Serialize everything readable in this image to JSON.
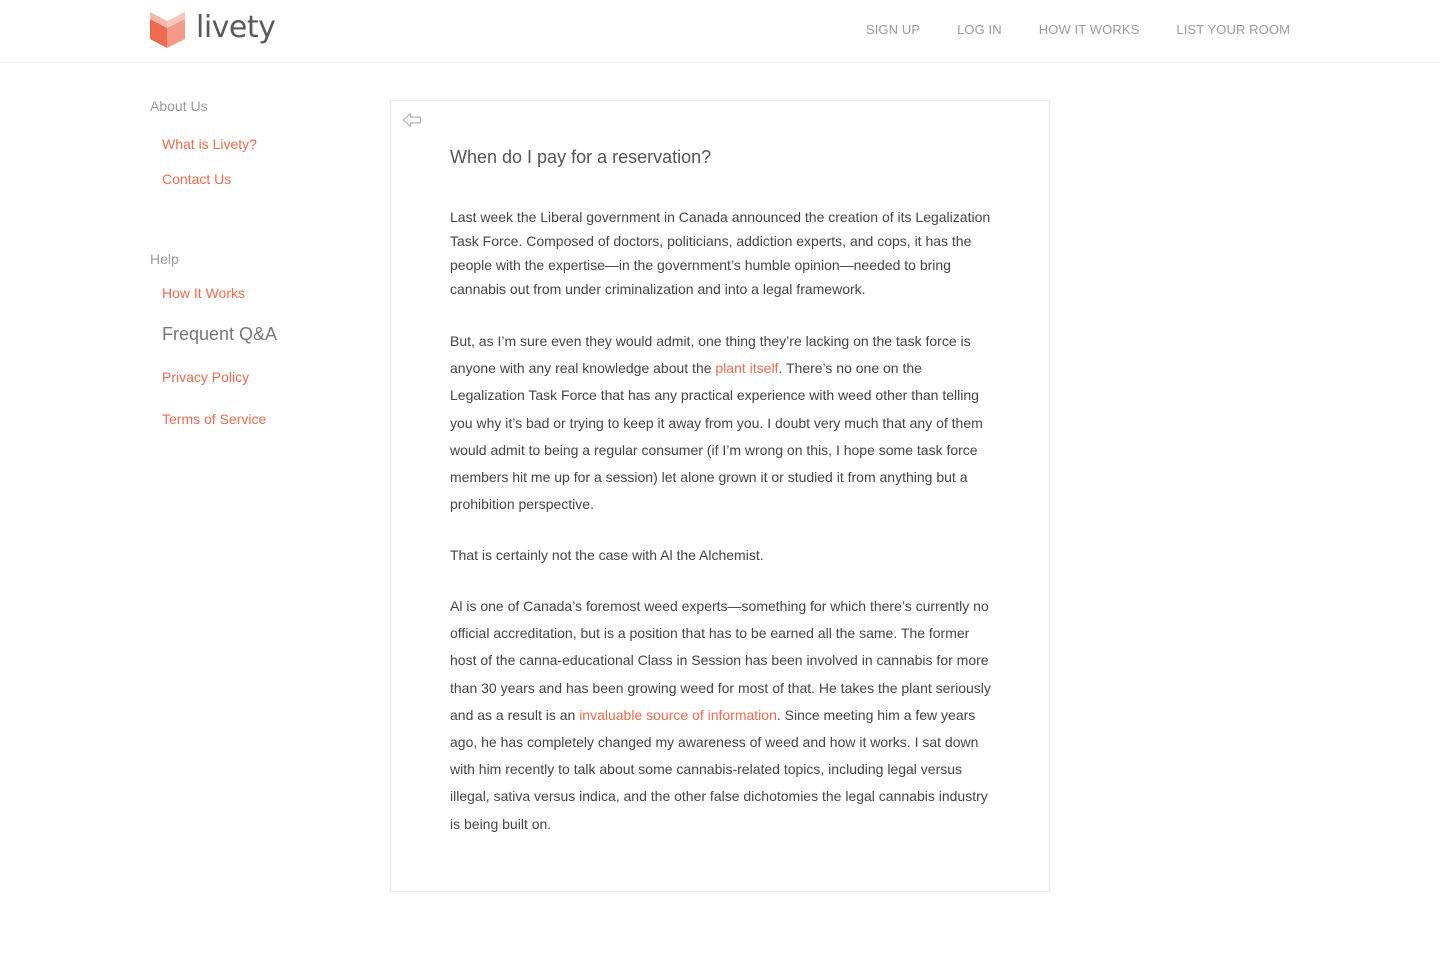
{
  "header": {
    "brand_name": "livety",
    "logo_color": "#ee6a50",
    "nav": [
      {
        "label": "SIGN UP"
      },
      {
        "label": "LOG IN"
      },
      {
        "label": "HOW IT WORKS"
      },
      {
        "label": "LIST YOUR ROOM"
      }
    ]
  },
  "sidebar": {
    "about_heading": "About Us",
    "about_links": [
      {
        "label": "What is Livety?"
      },
      {
        "label": "Contact Us"
      }
    ],
    "help_heading": "Help",
    "help_items": [
      {
        "label": "How It Works"
      },
      {
        "label": "Frequent Q&A",
        "active": true
      },
      {
        "label": "Privacy Policy"
      },
      {
        "label": "Terms of Service"
      }
    ]
  },
  "article": {
    "back_icon": "back-arrow-icon",
    "title": "When do I pay for a reservation?",
    "p1": "Last week the Liberal government in Canada announced the creation of its Legalization Task Force. Composed of doctors, politicians, addiction experts, and cops, it has the people with the expertise—in the government’s humble opinion—needed to bring cannabis out from under criminalization and into a legal framework.",
    "p2_before": "But, as I’m sure even they would admit, one thing they’re lacking on the task force is anyone with any real knowledge about the ",
    "p2_link": "plant itself",
    "p2_after": ". There’s no one on the Legalization Task Force that has any practical experience with weed other than telling you why it’s bad or trying to keep it away from you. I doubt very much that any of them would admit to being a regular consumer (if I’m wrong on this, I hope some task force members hit me up for a session) let alone grown it or studied it from anything but a prohibition perspective.",
    "p3": "That is certainly not the case with Al the Alchemist.",
    "p4_before": "Al is one of Canada’s foremost weed experts—something for which there’s currently no official accreditation, but is a position that has to be earned all the same. The former host of the canna-educational Class in Session has been involved in cannabis for more than 30 years and has been growing weed for most of that. He takes the plant seriously and as a result is an ",
    "p4_link": "invaluable source of information",
    "p4_after": ". Since meeting him a few years ago, he has completely changed my awareness of weed and how it works. I sat down with him recently to talk about some cannabis-related topics, including legal versus illegal, sativa versus indica, and the other false dichotomies the legal cannabis industry is being built on."
  }
}
